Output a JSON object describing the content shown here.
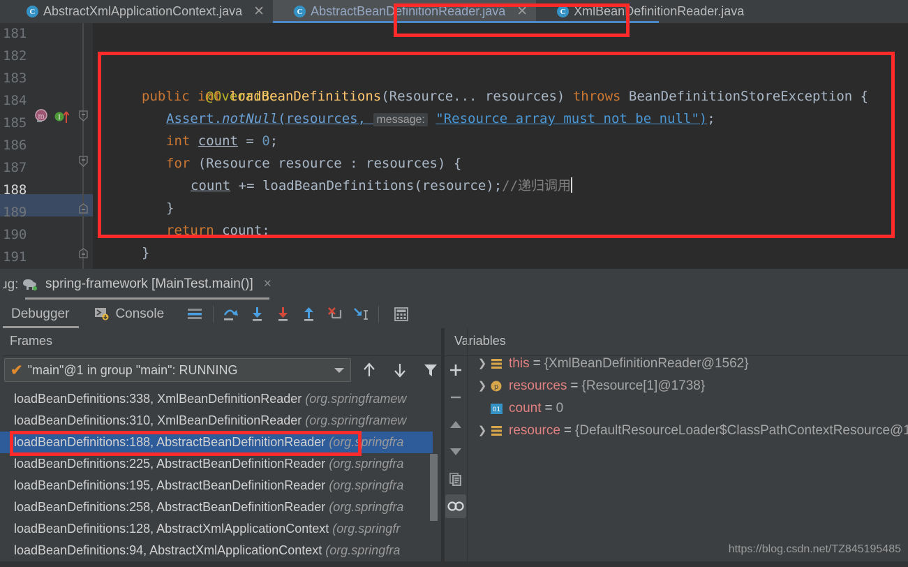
{
  "editor_tabs": [
    {
      "label": "AbstractXmlApplicationContext.java",
      "icon": "java-class-icon",
      "active": false,
      "closable": true
    },
    {
      "label": "AbstractBeanDefinitionReader.java",
      "icon": "java-class-icon",
      "active": true,
      "closable": true
    },
    {
      "label": "XmlBeanDefinitionReader.java",
      "icon": "java-class-icon",
      "active": false,
      "closable": false
    }
  ],
  "code": {
    "line_numbers": [
      "181",
      "182",
      "183",
      "184",
      "185",
      "186",
      "187",
      "188",
      "189",
      "190",
      "191"
    ],
    "current_line": "188",
    "lines": [
      {
        "n": "183",
        "text": "@Override"
      },
      {
        "n": "184",
        "text": "public int loadBeanDefinitions(Resource... resources) throws BeanDefinitionStoreException {"
      },
      {
        "n": "185",
        "text": "Assert.notNull(resources, message: \"Resource array must not be null\");",
        "hint": "message:"
      },
      {
        "n": "186",
        "text": "int count = 0;"
      },
      {
        "n": "187",
        "text": "for (Resource resource : resources) {"
      },
      {
        "n": "188",
        "text": "count += loadBeanDefinitions(resource);//递归调用"
      },
      {
        "n": "189",
        "text": "}"
      },
      {
        "n": "190",
        "text": "return count;"
      },
      {
        "n": "191",
        "text": "}"
      }
    ],
    "tokens": {
      "annotation": "@Override",
      "kw_public": "public",
      "kw_int": "int",
      "kw_throws": "throws",
      "kw_for": "for",
      "kw_return": "return",
      "method_name": "loadBeanDefinitions",
      "param_type": "Resource...",
      "param_name": "resources",
      "exception": "BeanDefinitionStoreException",
      "assert_class": "Assert",
      "assert_method": "notNull",
      "hint_message": "message:",
      "string_literal": "\"Resource array must not be null\"",
      "var_count": "count",
      "zero": "0",
      "resource_type": "Resource",
      "resource_var": "resource",
      "comment": "//递归调用"
    }
  },
  "debug_window": {
    "title": "ug:",
    "run_config": "spring-framework [MainTest.main()]",
    "run_config_icon": "elephant-gradle-icon",
    "close_label": "×",
    "tabs": [
      {
        "label": "Debugger",
        "selected": true
      },
      {
        "label": "Console",
        "selected": false,
        "icon": "console-icon"
      }
    ],
    "toolbar_buttons": [
      {
        "name": "show-execution-point-icon",
        "title": "Show Execution Point"
      },
      {
        "name": "step-over-icon",
        "title": "Step Over"
      },
      {
        "name": "step-into-icon",
        "title": "Step Into"
      },
      {
        "name": "force-step-into-icon",
        "title": "Force Step Into"
      },
      {
        "name": "step-out-icon",
        "title": "Step Out"
      },
      {
        "name": "drop-frame-icon",
        "title": "Drop Frame"
      },
      {
        "name": "run-to-cursor-icon",
        "title": "Run to Cursor"
      },
      {
        "name": "evaluate-expression-icon",
        "title": "Evaluate Expression"
      }
    ]
  },
  "frames": {
    "title": "Frames",
    "thread": "\"main\"@1 in group \"main\": RUNNING",
    "thread_status_icon": "check-icon",
    "actions": [
      {
        "name": "move-up-icon",
        "glyph": "↑"
      },
      {
        "name": "move-down-icon",
        "glyph": "↓"
      },
      {
        "name": "filter-icon",
        "glyph": "filter"
      }
    ],
    "rows": [
      {
        "method": "loadBeanDefinitions:338, XmlBeanDefinitionReader",
        "pkg": "(org.springframew",
        "selected": false
      },
      {
        "method": "loadBeanDefinitions:310, XmlBeanDefinitionReader",
        "pkg": "(org.springframew",
        "selected": false
      },
      {
        "method": "loadBeanDefinitions:188, AbstractBeanDefinitionReader",
        "pkg": "(org.springfra",
        "selected": true
      },
      {
        "method": "loadBeanDefinitions:225, AbstractBeanDefinitionReader",
        "pkg": "(org.springfra",
        "selected": false
      },
      {
        "method": "loadBeanDefinitions:195, AbstractBeanDefinitionReader",
        "pkg": "(org.springfra",
        "selected": false
      },
      {
        "method": "loadBeanDefinitions:258, AbstractBeanDefinitionReader",
        "pkg": "(org.springfra",
        "selected": false
      },
      {
        "method": "loadBeanDefinitions:128, AbstractXmlApplicationContext",
        "pkg": "(org.springfr",
        "selected": false
      },
      {
        "method": "loadBeanDefinitions:94, AbstractXmlApplicationContext",
        "pkg": "(org.springfra",
        "selected": false
      }
    ]
  },
  "variables": {
    "title": "Variables",
    "sidebar_buttons": [
      {
        "name": "add-watch-icon",
        "glyph": "+",
        "active": false
      },
      {
        "name": "remove-watch-icon",
        "glyph": "−",
        "active": false
      },
      {
        "name": "move-watch-up-icon",
        "glyph": "▲",
        "active": false
      },
      {
        "name": "move-watch-down-icon",
        "glyph": "▼",
        "active": false
      },
      {
        "name": "copy-value-icon",
        "glyph": "copy",
        "active": false
      },
      {
        "name": "watches-icon",
        "glyph": "glasses",
        "active": true
      }
    ],
    "rows": [
      {
        "expandable": true,
        "icon": "object-field-icon",
        "name": "this",
        "value": "{XmlBeanDefinitionReader@1562}"
      },
      {
        "expandable": true,
        "icon": "parameter-icon",
        "name": "resources",
        "value": "{Resource[1]@1738}"
      },
      {
        "expandable": false,
        "icon": "primitive-value-icon",
        "name": "count",
        "value": "0"
      },
      {
        "expandable": true,
        "icon": "object-field-icon",
        "name": "resource",
        "value": "{DefaultResourceLoader$ClassPathContextResource@1"
      }
    ],
    "equals_sign": "="
  },
  "watermark": "https://blog.csdn.net/TZ845195485",
  "colors": {
    "accent_blue": "#4a88c7",
    "selection_blue": "#2e5b99",
    "annotation_red": "#ff2a2a",
    "editor_bg": "#2b2b2b",
    "panel_bg": "#3c3f41",
    "keyword_orange": "#cc7832",
    "method_yellow": "#ffc66d",
    "string_blue": "#4b97d4",
    "annotation_yellow": "#bbb529",
    "number_blue": "#6897bb",
    "var_name_red": "#e08080"
  }
}
